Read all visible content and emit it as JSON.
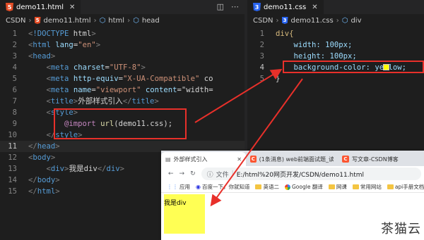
{
  "left_editor": {
    "tab_title": "demo11.html",
    "breadcrumb": [
      "CSDN",
      "demo11.html",
      "html",
      "head"
    ],
    "code": [
      "<!DOCTYPE html>",
      "<html lang=\"en\">",
      "<head>",
      "    <meta charset=\"UTF-8\">",
      "    <meta http-equiv=\"X-UA-Compatible\" co",
      "    <meta name=\"viewport\" content=\"width=",
      "    <title>外部样式引入</title>",
      "    <style>",
      "        @import url(demo11.css);",
      "    </style>",
      "</head>",
      "<body>",
      "    <div>我是div</div>",
      "</body>",
      "</html>"
    ],
    "line_numbers": [
      "1",
      "2",
      "3",
      "4",
      "5",
      "6",
      "7",
      "8",
      "9",
      "10",
      "11",
      "12",
      "13",
      "14",
      "15"
    ]
  },
  "right_editor": {
    "tab_title": "demo11.css",
    "breadcrumb": [
      "CSDN",
      "demo11.css",
      "div"
    ],
    "line_numbers": [
      "1",
      "2",
      "3",
      "4",
      "5"
    ],
    "code": [
      "div{",
      "    width: 100px;",
      "    height: 100px;",
      "    background-color: yellow;",
      "}"
    ]
  },
  "browser": {
    "tabs": [
      "外部样式引入",
      "(1条消息) web前端面试题_读影...",
      "写文章-CSDN博客"
    ],
    "address_label": "文件",
    "address": "E:/html%20网页开发/CSDN/demo11.html",
    "bookmarks": [
      "应用",
      "百度一下，你就知道",
      "英语二",
      "Google 翻译",
      "网课",
      "常用网站",
      "api手册文档"
    ],
    "div_text": "我是div"
  },
  "watermark": "茶猫云",
  "colors": {
    "highlight_box": "#e8302a",
    "div_bg": "#ffff54"
  }
}
